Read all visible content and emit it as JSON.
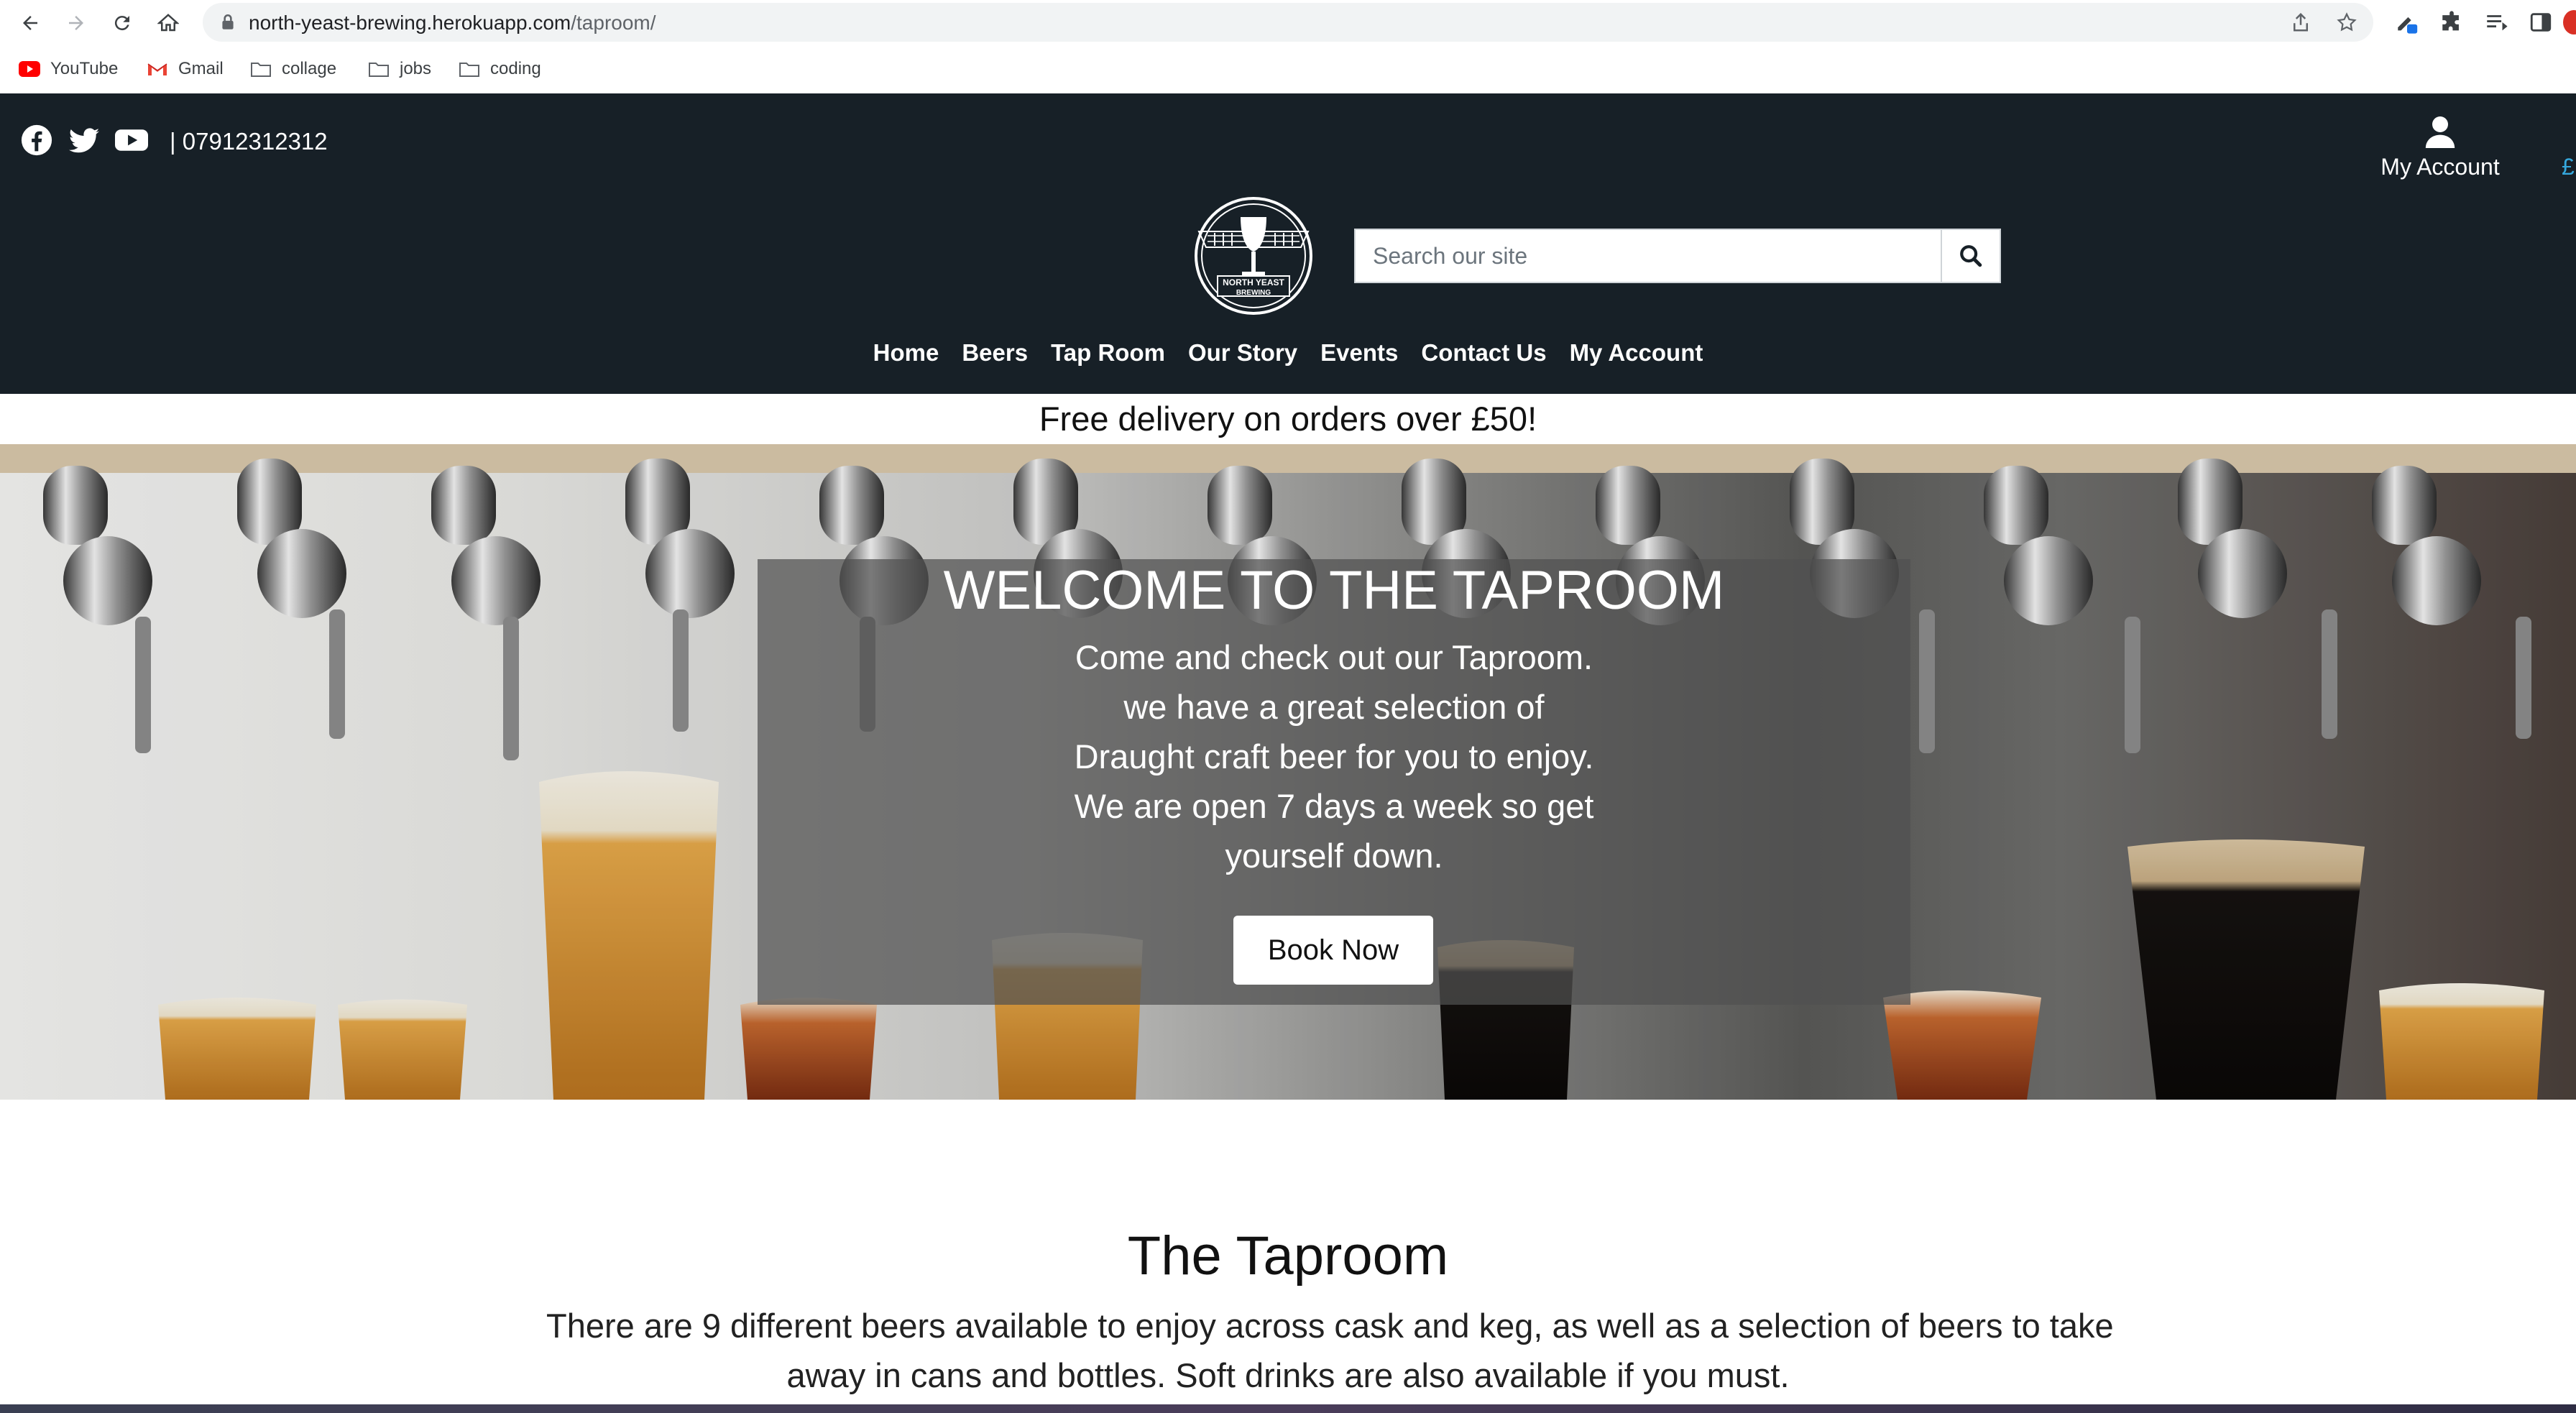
{
  "browser": {
    "url_host": "north-yeast-brewing.herokuapp.com",
    "url_path": "/taproom/",
    "bookmarks": [
      {
        "label": "YouTube",
        "icon": "youtube-icon"
      },
      {
        "label": "Gmail",
        "icon": "gmail-icon"
      },
      {
        "label": "collage",
        "icon": "folder-icon"
      },
      {
        "label": "jobs",
        "icon": "folder-icon"
      },
      {
        "label": "coding",
        "icon": "folder-icon"
      }
    ]
  },
  "header": {
    "social_icons": [
      "facebook-icon",
      "twitter-icon",
      "youtube-icon"
    ],
    "phone": "| 07912312312",
    "account_label": "My Account",
    "bag_peek": "£",
    "logo_text": [
      "NORTH YEAST",
      "BREWING"
    ],
    "search_placeholder": "Search our site",
    "nav": [
      "Home",
      "Beers",
      "Tap Room",
      "Our Story",
      "Events",
      "Contact Us",
      "My Account"
    ]
  },
  "banner": {
    "text": "Free delivery on orders over £50!"
  },
  "hero": {
    "title": "WELCOME TO THE TAPROOM",
    "lines": [
      "Come and check out our Taproom.",
      "we have a great selection of",
      "Draught craft beer for you to enjoy.",
      "We are open 7 days a week so get",
      "yourself down."
    ],
    "button": "Book Now"
  },
  "taproom": {
    "title": "The Taproom",
    "lines": [
      "There are 9 different beers available to enjoy across cask and keg, as well as a selection of beers to take",
      "away in cans and bottles. Soft drinks are also available if you must."
    ]
  },
  "colors": {
    "header_bg": "#172027",
    "accent": "#35a8dd"
  }
}
